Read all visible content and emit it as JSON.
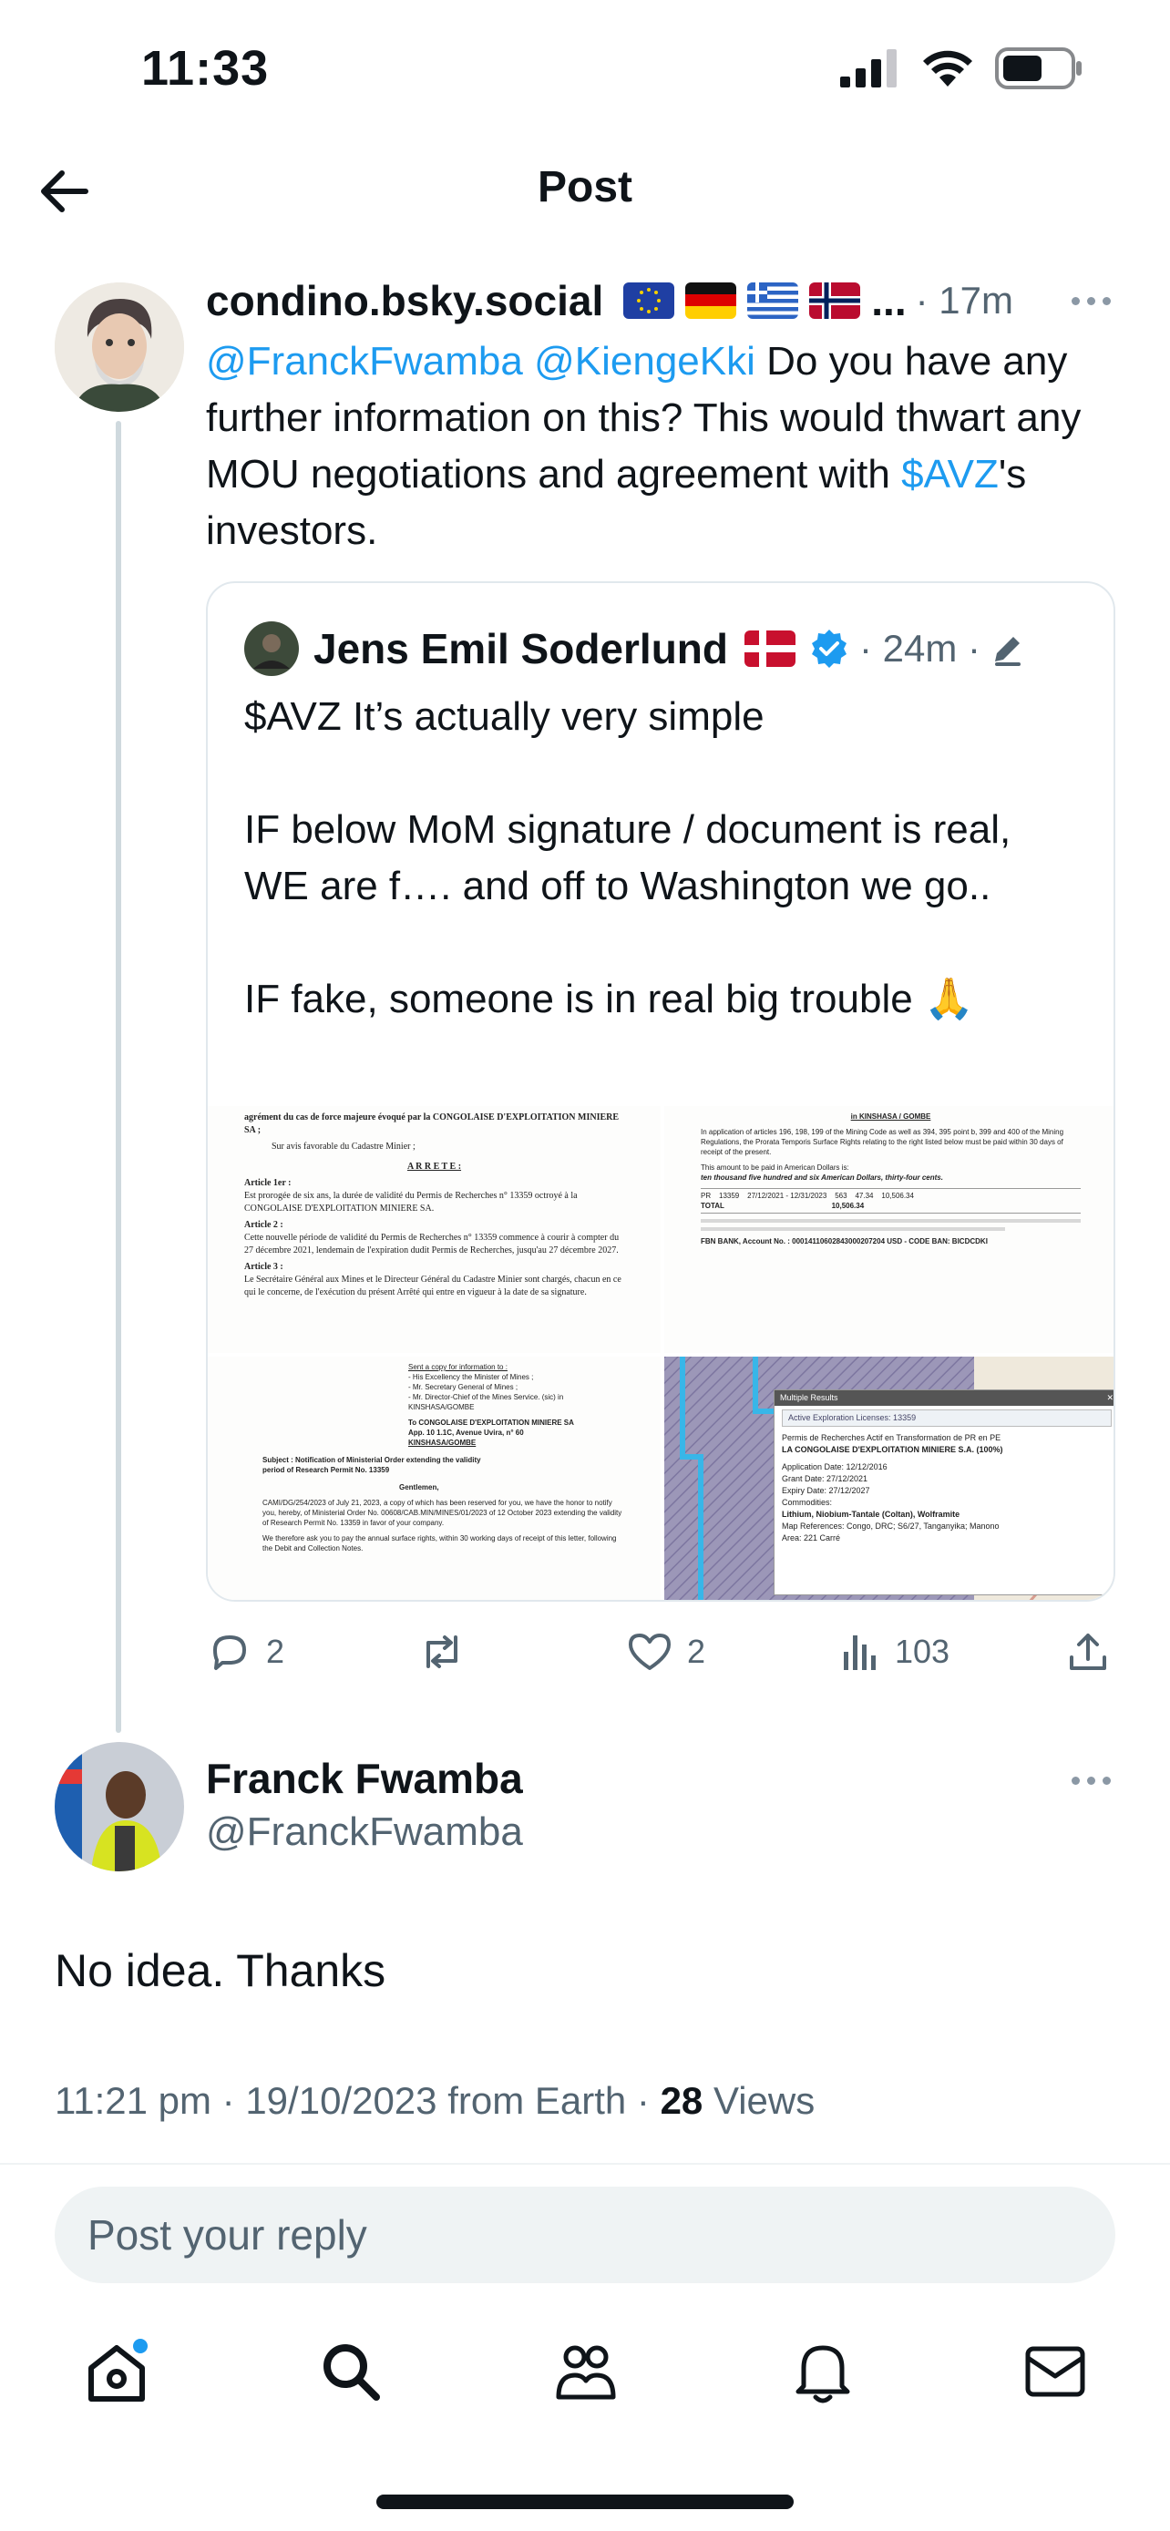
{
  "status_bar": {
    "time": "11:33"
  },
  "header": {
    "title": "Post"
  },
  "tweet": {
    "handle": "condino.bsky.social",
    "flags_trail": "...",
    "time": "· 17m",
    "mention1": "@FranckFwamba",
    "mention2": "@KiengeKki",
    "text_part1": " Do you have any further information on this? This would thwart any MOU negotiations and agreement with ",
    "cashtag": "$AVZ",
    "text_part2": "'s investors."
  },
  "quote": {
    "name": "Jens Emil Soderlund",
    "time": "· 24m ·",
    "para1": "$AVZ It’s actually very simple",
    "para2": "IF below MoM signature / document is real, WE are f…. and off to Washington we go..",
    "para3": "IF fake, someone is in real big trouble 🙏",
    "doc1": {
      "line1": "agrément du cas de force majeure évoqué par la CONGOLAISE D'EXPLOITATION MINIERE SA ;",
      "line2": "Sur avis favorable du Cadastre Minier ;",
      "heading": "A R R E T E :",
      "art1": "Article 1er :",
      "art1_text": "Est prorogée de six ans, la durée de validité du Permis de Recherches n° 13359 octroyé à la CONGOLAISE D'EXPLOITATION MINIERE SA.",
      "art2": "Article 2 :",
      "art2_text": "Cette nouvelle période de validité du Permis de Recherches n° 13359 commence à courir à compter du 27 décembre 2021, lendemain de l'expiration dudit Permis de Recherches, jusqu'au 27 décembre 2027.",
      "art3": "Article 3 :",
      "art3_text": "Le Secrétaire Général aux Mines et le Directeur Général du Cadastre Minier sont chargés, chacun en ce qui le concerne, de l'exécution du présent Arrêté qui entre en vigueur à la date de sa signature."
    },
    "doc2": {
      "title": "in KINSHASA / GOMBE",
      "p1": "In application of articles 196, 198, 199 of the Mining Code as well as 394, 395 point b, 399 and 400 of the Mining Regulations, the Prorata Temporis Surface Rights relating to the right listed below must be paid within 30 days of receipt of the present.",
      "p2": "This amount to be paid in American Dollars is:",
      "p3": "ten thousand five hundred and six American Dollars, thirty-four cents.",
      "row": "PR    13359    27/12/2021 - 12/31/2023    563    47.34    10,506.34",
      "total": "TOTAL                                                     10,506.34",
      "bank": "FBN BANK, Account No. : 00014110602843000207204 USD - CODE BAN: BICDCDKI"
    },
    "doc3": {
      "copy": "Sent a copy for information to :",
      "c1": "- His Excellency the Minister of Mines ;",
      "c2": "- Mr. Secretary General of Mines ;",
      "c3": "- Mr. Director-Chief of the Mines Service. (sic) in KINSHASA/GOMBE",
      "to": "To CONGOLAISE D'EXPLOITATION MINIERE SA",
      "addr": "App. 10 1.1C, Avenue Uvira, n° 60",
      "city": "KINSHASA/GOMBE",
      "subject": "Subject : Notification of Ministerial Order extending the validity period of Research Permit No. 13359",
      "greet": "Gentlemen,",
      "body": "CAMI/DG/254/2023 of July 21, 2023, a copy of which has been reserved for you, we have the honor to notify you, hereby, of Ministerial Order No. 00608/CAB.MIN/MINES/01/2023 of 12 October 2023 extending the validity of Research Permit No. 13359 in favor of your company.",
      "pay": "We therefore ask you to pay the annual surface rights, within 30 working days of receipt of this letter, following the Debit and Collection Notes."
    },
    "map": {
      "popup_title": "Multiple Results",
      "license": "Active Exploration Licenses: 13359",
      "type": "Permis de Recherches Actif en Transformation de PR en PE",
      "company": "LA CONGOLAISE D'EXPLOITATION MINIERE S.A. (100%)",
      "app_date": "Application Date: 12/12/2016",
      "grant": "Grant Date: 27/12/2021",
      "expiry": "Expiry Date: 27/12/2027",
      "commod_label": "Commodities:",
      "commod": "Lithium, Niobium-Tantale (Coltan), Wolframite",
      "refs": "Map References: Congo, DRC; S6/27, Tanganyika; Manono",
      "area": "Area: 221 Carré"
    }
  },
  "actions": {
    "replies": "2",
    "likes": "2",
    "views": "103"
  },
  "reply": {
    "name": "Franck Fwamba",
    "handle": "@FranckFwamba",
    "text": "No idea. Thanks",
    "meta": "11:21 pm · 19/10/2023 from Earth · ",
    "views_count": "28",
    "views_label": " Views"
  },
  "composer": {
    "placeholder": "Post your reply"
  },
  "colors": {
    "accent": "#1d9bf0",
    "muted": "#536471",
    "text": "#0f1419"
  },
  "icons": [
    "back-arrow-icon",
    "signal-icon",
    "wifi-icon",
    "battery-icon",
    "verified-icon",
    "edit-icon",
    "reply-icon",
    "repost-icon",
    "like-icon",
    "views-icon",
    "share-icon",
    "home-icon",
    "search-icon",
    "communities-icon",
    "notifications-icon",
    "messages-icon"
  ]
}
